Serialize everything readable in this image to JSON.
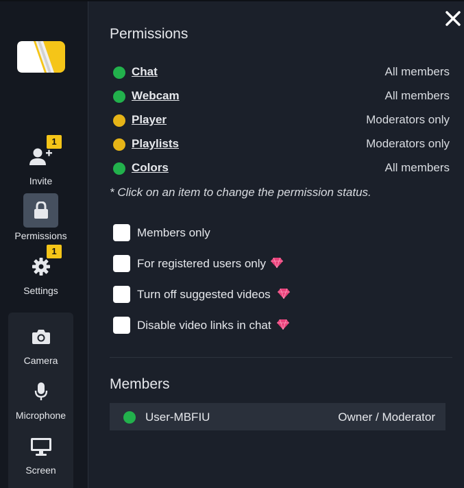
{
  "colors": {
    "green": "#22b14c",
    "yellow": "#e6b417",
    "badge": "#f5c518",
    "gem": "#e9417a",
    "logo_yellow": "#f5c518"
  },
  "sidebar": {
    "invite": {
      "label": "Invite",
      "badge": "1",
      "icon": "add-user-icon"
    },
    "permissions": {
      "label": "Permissions",
      "icon": "lock-icon"
    },
    "settings": {
      "label": "Settings",
      "badge": "1",
      "icon": "gear-icon"
    },
    "camera": {
      "label": "Camera",
      "icon": "camera-icon"
    },
    "microphone": {
      "label": "Microphone",
      "icon": "microphone-icon"
    },
    "screen": {
      "label": "Screen",
      "icon": "monitor-icon"
    }
  },
  "permissions": {
    "title": "Permissions",
    "items": [
      {
        "name": "Chat",
        "value": "All members",
        "status": "green"
      },
      {
        "name": "Webcam",
        "value": "All members",
        "status": "green"
      },
      {
        "name": "Player",
        "value": "Moderators only",
        "status": "yellow"
      },
      {
        "name": "Playlists",
        "value": "Moderators only",
        "status": "yellow"
      },
      {
        "name": "Colors",
        "value": "All members",
        "status": "green"
      }
    ],
    "note": "* Click on an item to change the permission status.",
    "options": [
      {
        "label": "Members only",
        "checked": false,
        "premium": false
      },
      {
        "label": "For registered users only",
        "checked": false,
        "premium": true
      },
      {
        "label": "Turn off suggested videos",
        "checked": false,
        "premium": true
      },
      {
        "label": "Disable video links in chat",
        "checked": false,
        "premium": true
      }
    ]
  },
  "members": {
    "title": "Members",
    "list": [
      {
        "name": "User-MBFIU",
        "role": "Owner / Moderator",
        "status": "green"
      }
    ]
  }
}
